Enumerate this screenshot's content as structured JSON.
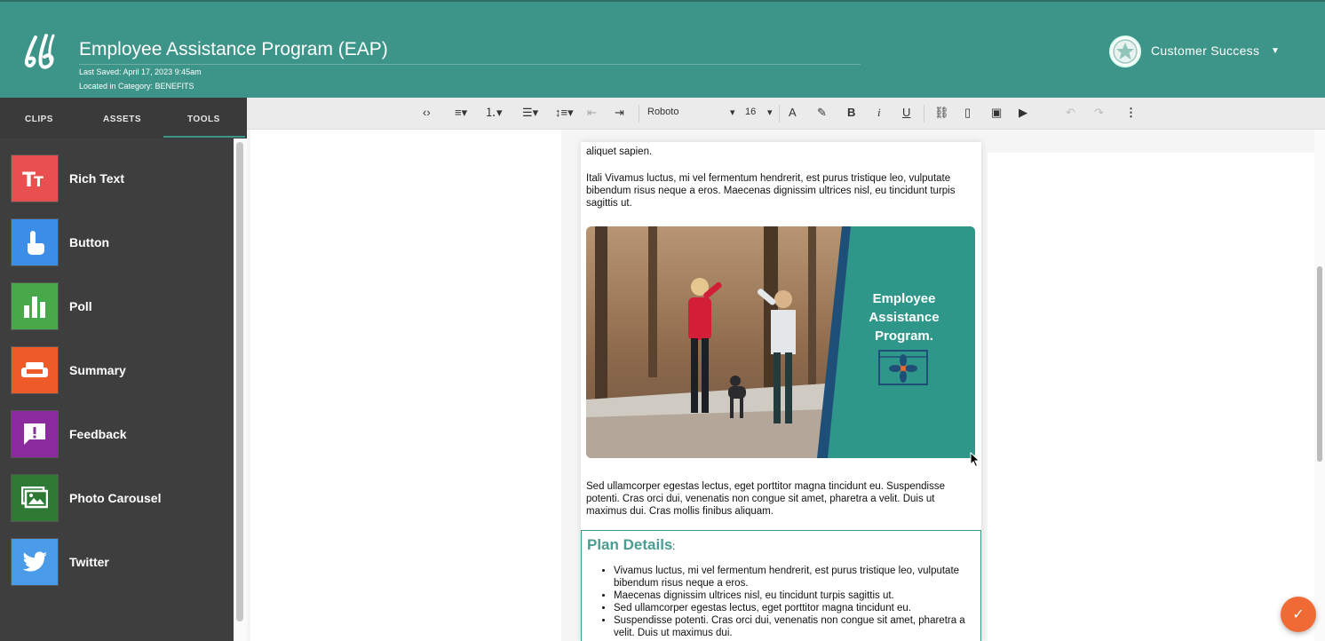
{
  "header": {
    "title": "Employee Assistance Program (EAP)",
    "last_saved": "Last Saved: April 17, 2023 9:45am",
    "category": "Located in Category: BENEFITS",
    "user_name": "Customer Success",
    "brand_color": "#3d9488"
  },
  "sidebar": {
    "tabs": [
      "CLIPS",
      "ASSETS",
      "TOOLS"
    ],
    "active_tab": "TOOLS",
    "tools": [
      {
        "label": "Rich Text",
        "icon": "text-icon",
        "color": "#e8504f"
      },
      {
        "label": "Button",
        "icon": "tap-icon",
        "color": "#3b8de6"
      },
      {
        "label": "Poll",
        "icon": "bar-chart-icon",
        "color": "#49a84a"
      },
      {
        "label": "Summary",
        "icon": "couch-icon",
        "color": "#ee5a28"
      },
      {
        "label": "Feedback",
        "icon": "feedback-icon",
        "color": "#8c2a9f"
      },
      {
        "label": "Photo Carousel",
        "icon": "photo-icon",
        "color": "#2e7a34"
      },
      {
        "label": "Twitter",
        "icon": "twitter-icon",
        "color": "#4a9be8"
      }
    ]
  },
  "toolbar": {
    "font_family": "Roboto",
    "font_size": "16"
  },
  "content": {
    "para_cut": "aliquet sapien.",
    "para1": "Itali Vivamus luctus, mi vel fermentum hendrerit, est purus tristique leo, vulputate bibendum risus neque a eros. Maecenas dignissim ultrices nisl, eu tincidunt turpis sagittis ut.",
    "hero_heading": [
      "Employee",
      "Assistance",
      "Program."
    ],
    "para2": "Sed ullamcorper egestas lectus, eget porttitor magna tincidunt eu. Suspendisse potenti. Cras orci dui, venenatis non congue sit amet, pharetra a velit. Duis ut maximus dui. Cras mollis finibus aliquam.",
    "plan_title": "Plan Details",
    "plan_colon": ":",
    "plan_items": [
      "Vivamus luctus, mi vel fermentum hendrerit, est purus tristique leo, vulputate bibendum risus neque a eros.",
      "Maecenas dignissim ultrices nisl, eu tincidunt turpis sagittis ut.",
      "Sed ullamcorper egestas lectus, eget porttitor magna tincidunt eu.",
      "Suspendisse potenti. Cras orci dui, venenatis non congue sit amet, pharetra a velit. Duis ut maximus dui."
    ]
  }
}
